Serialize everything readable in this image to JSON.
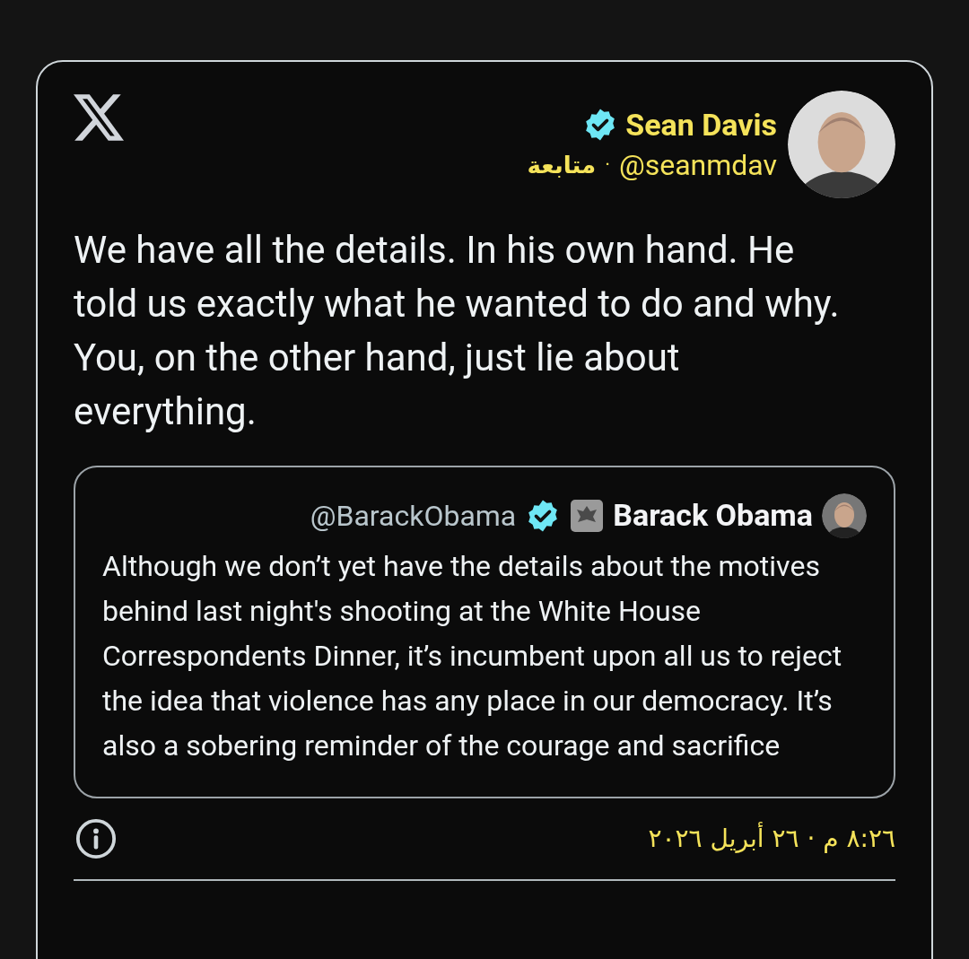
{
  "post": {
    "author": {
      "name": "Sean Davis",
      "verified": true,
      "handle": "@seanmdav",
      "separator": "·",
      "follow_label": "متابعة"
    },
    "text": "We have all the details. In his own hand. He told us exactly what he wanted to do and why. You, on the other hand, just lie about everything.",
    "quoted": {
      "handle": "@BarackObama",
      "verified": true,
      "name": "Barack Obama",
      "text": "Although we don’t yet have the details about the motives behind last night's shooting at the White House Correspondents Dinner, it’s incumbent upon all us to reject the idea that violence has any place in our democracy. It’s also a sobering reminder of the courage and sacrifice"
    },
    "timestamp": "٨:٢٦ م · ٢٦ أبريل ٢٠٢٦"
  }
}
